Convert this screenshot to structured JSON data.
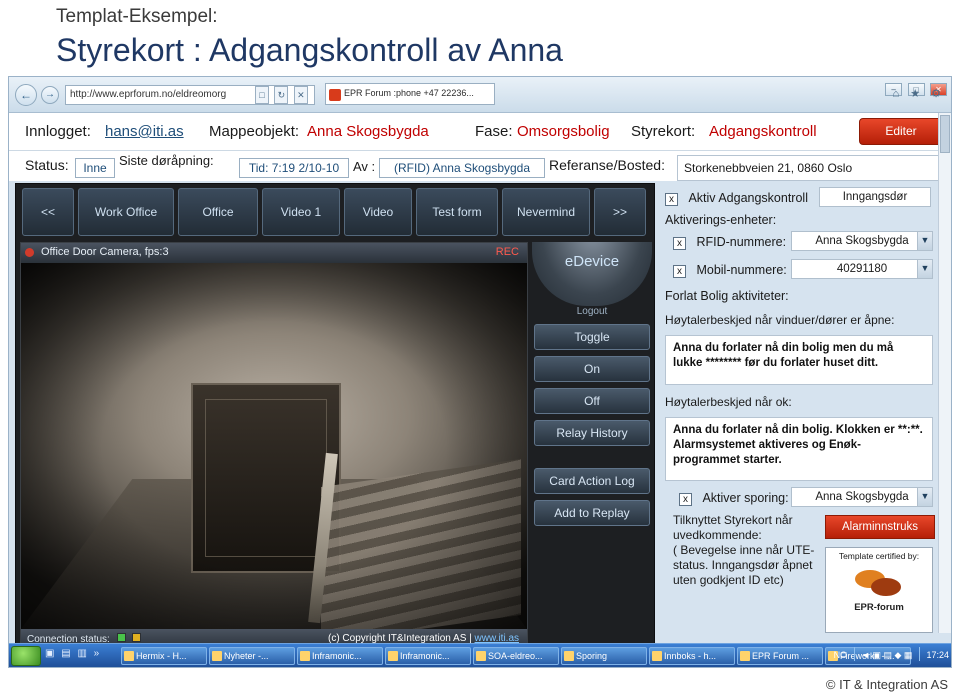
{
  "slide": {
    "subtitle": "Templat-Eksempel:",
    "title": "Styrekort : Adgangskontroll av Anna",
    "footer": "© IT & Integration AS"
  },
  "browser": {
    "url": "http://www.eprforum.no/eldreomorg",
    "tab_title": "EPR Forum :phone +47 22236...",
    "back_icon": "←",
    "forward_icon": "→",
    "url_controls": [
      "□",
      "↻",
      "✕"
    ],
    "window_buttons": [
      "–",
      "□",
      "✕"
    ],
    "right_icons": "⌂ ★ ⚙"
  },
  "strip": {
    "logged_in_label": "Innlogget:",
    "logged_in_user": "hans@iti.as",
    "folder_label": "Mappeobjekt:",
    "folder_value": "Anna Skogsbygda",
    "phase_label": "Fase:",
    "phase_value": "Omsorgsbolig",
    "card_label": "Styrekort:",
    "card_value": "Adgangskontroll",
    "edit_button": "Editer"
  },
  "status": {
    "status_label": "Status:",
    "status_value": "Inne",
    "last_open_label": "Siste døråpning:",
    "time_value": "Tid: 7:19 2/10-10",
    "by_label": "Av :",
    "by_value": "(RFID) Anna Skogsbygda",
    "reference_label": "Referanse/Bosted:",
    "address_value": "Storkenebbveien 21, 0860 Oslo"
  },
  "app": {
    "tabs": [
      "<<",
      "Work Office",
      "Office",
      "Video 1",
      "Video",
      "Test form",
      "Nevermind",
      ">>"
    ],
    "device_title": "eDevice",
    "logout": "Logout",
    "side_buttons": [
      "Toggle",
      "On",
      "Off",
      "Relay History",
      "Card Action Log",
      "Add to Replay"
    ],
    "camera_title": "Office Door Camera, fps:3",
    "rec_label": "REC",
    "connection_label": "Connection status:",
    "copyright": "(c) Copyright IT&Integration AS |",
    "copyright_link": "www.iti.as"
  },
  "form": {
    "access_checkbox": "x",
    "access_label": "Aktiv Adgangskontroll",
    "door_value": "Inngangsdør",
    "units_label": "Aktiverings-enheter:",
    "rfid_checkbox": "x",
    "rfid_label": "RFID-nummere:",
    "rfid_value": "Anna Skogsbygda",
    "mobile_checkbox": "x",
    "mobile_label": "Mobil-nummere:",
    "mobile_value": "40291180",
    "leave_title": "Forlat Bolig aktiviteter:",
    "speaker_open_label": "Høytalerbeskjed når vinduer/dører er  åpne:",
    "speaker_open_text": "Anna  du forlater nå din bolig men du må lukke ******** før du forlater huset ditt.",
    "speaker_ok_label": "Høytalerbeskjed når ok:",
    "speaker_ok_text": "Anna  du forlater nå din bolig. Klokken er **:**.  Alarmsystemet aktiveres og Enøk-programmet starter.",
    "tracking_checkbox": "x",
    "tracking_label": "Aktiver sporing:",
    "tracking_value": "Anna Skogsbygda",
    "linked_text": "Tilknyttet Styrekort når uvedkommende:\n( Bevegelse inne når UTE-status. Inngangsdør åpnet uten godkjent ID etc)",
    "alarm_button": "Alarminnstruks",
    "cert_caption": "Template certified by:",
    "cert_name": "EPR-forum"
  },
  "taskbar": {
    "items": [
      "Hermix - H...",
      "Nyheter -...",
      "Inframonic...",
      "Inframonic...",
      "SOA-eldreo...",
      "Sporing",
      "Innboks - h...",
      "EPR Forum ...",
      "Fireworks - ..."
    ],
    "tray_lang": "NO",
    "tray_time": "17:24"
  },
  "colors": {
    "accent_red": "#c00000",
    "title_blue": "#1f3864",
    "link_blue": "#1f4e79"
  }
}
